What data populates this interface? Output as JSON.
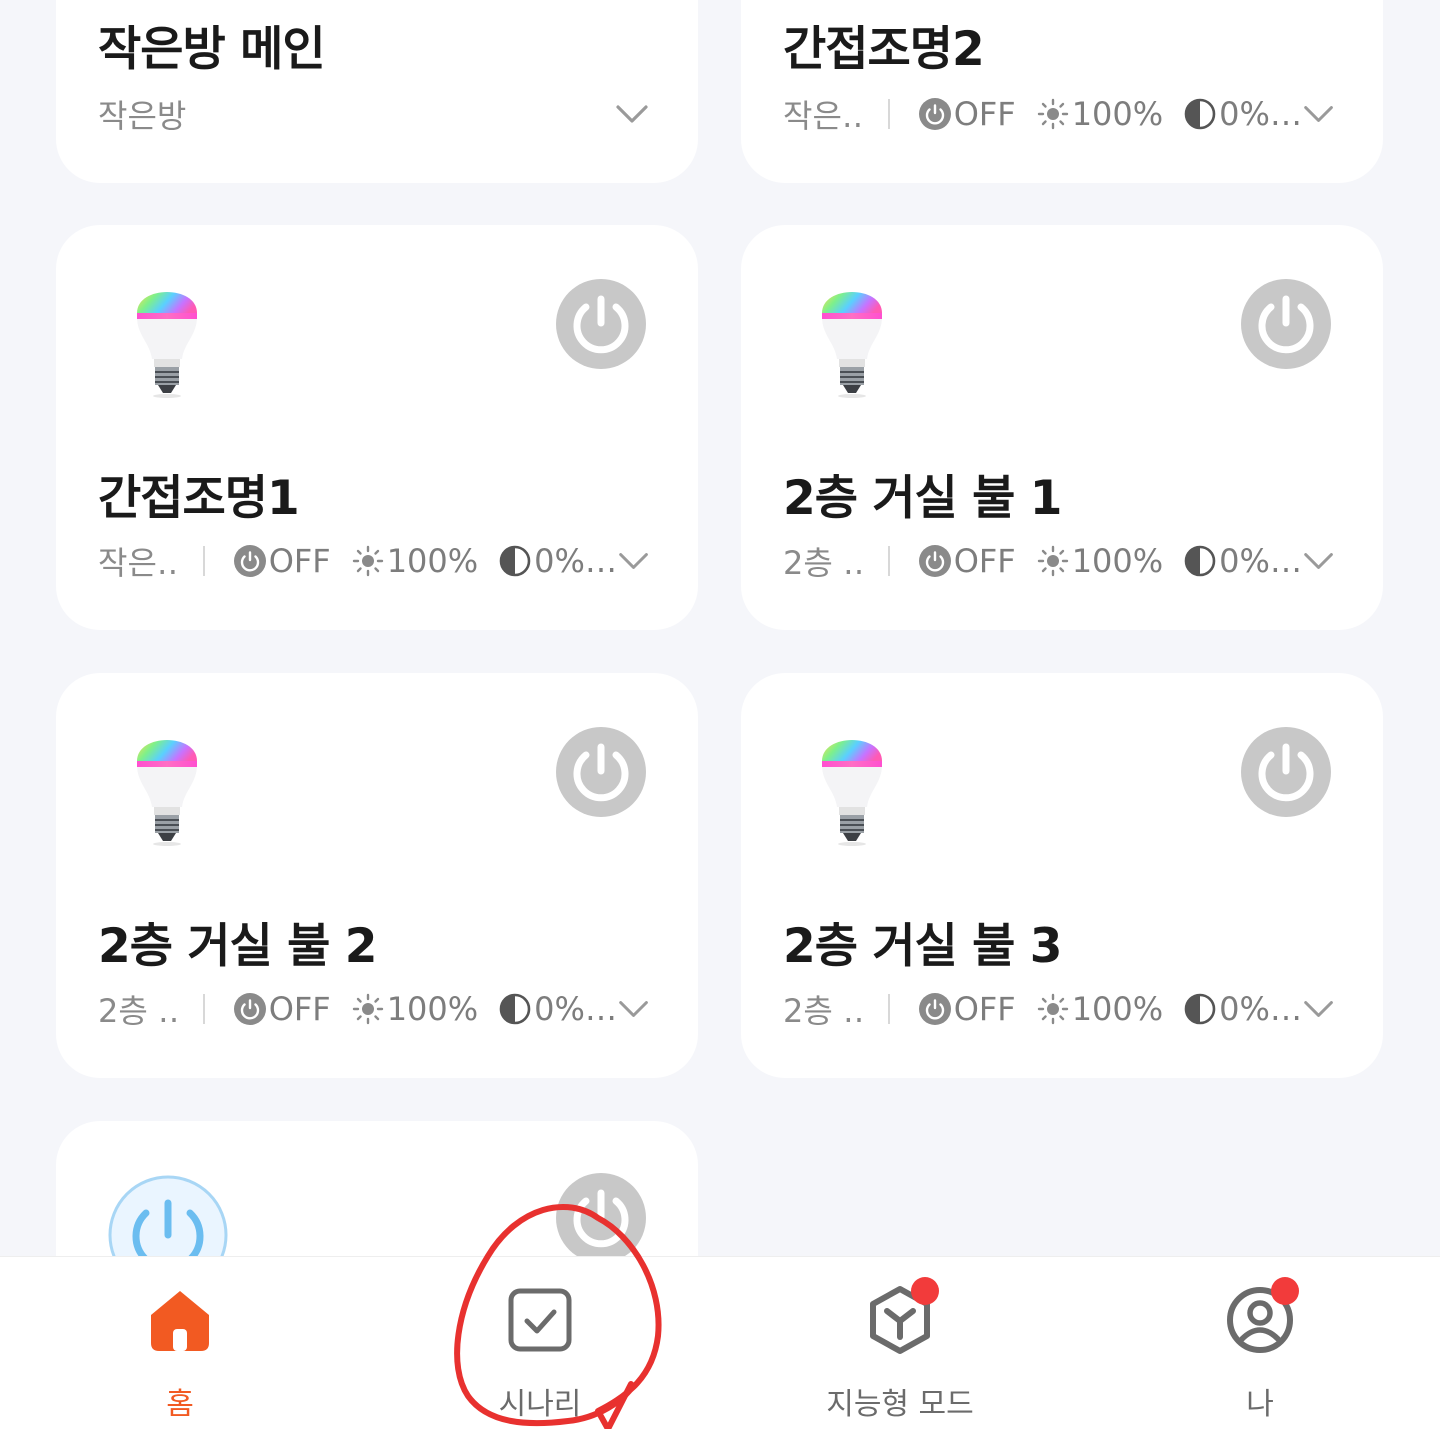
{
  "cards": [
    {
      "title": "작은방 메인",
      "room": "작은방"
    },
    {
      "title": "간접조명2",
      "room": "작은…",
      "power": "OFF",
      "brightness": "100%",
      "temp": "0%…"
    },
    {
      "title": "간접조명1",
      "room": "작은…",
      "power": "OFF",
      "brightness": "100%",
      "temp": "0%…"
    },
    {
      "title": "2층 거실 불 1",
      "room": "2층 …",
      "power": "OFF",
      "brightness": "100%",
      "temp": "0%…"
    },
    {
      "title": "2층 거실 불 2",
      "room": "2층 …",
      "power": "OFF",
      "brightness": "100%",
      "temp": "0%…"
    },
    {
      "title": "2층 거실 불 3",
      "room": "2층 …",
      "power": "OFF",
      "brightness": "100%",
      "temp": "0%…"
    }
  ],
  "tabs": [
    {
      "label": "홈",
      "icon": "home-icon",
      "active": true
    },
    {
      "label": "시나리",
      "icon": "scenario-check-icon",
      "active": false
    },
    {
      "label": "지능형 모드",
      "icon": "smart-mode-icon",
      "active": false,
      "badge": true
    },
    {
      "label": "나",
      "icon": "profile-icon",
      "active": false,
      "badge": true
    }
  ],
  "colors": {
    "accent": "#f25a22",
    "badge": "#f23b3b",
    "power_off": "#c8c8c8",
    "annotation": "#e8312f"
  }
}
